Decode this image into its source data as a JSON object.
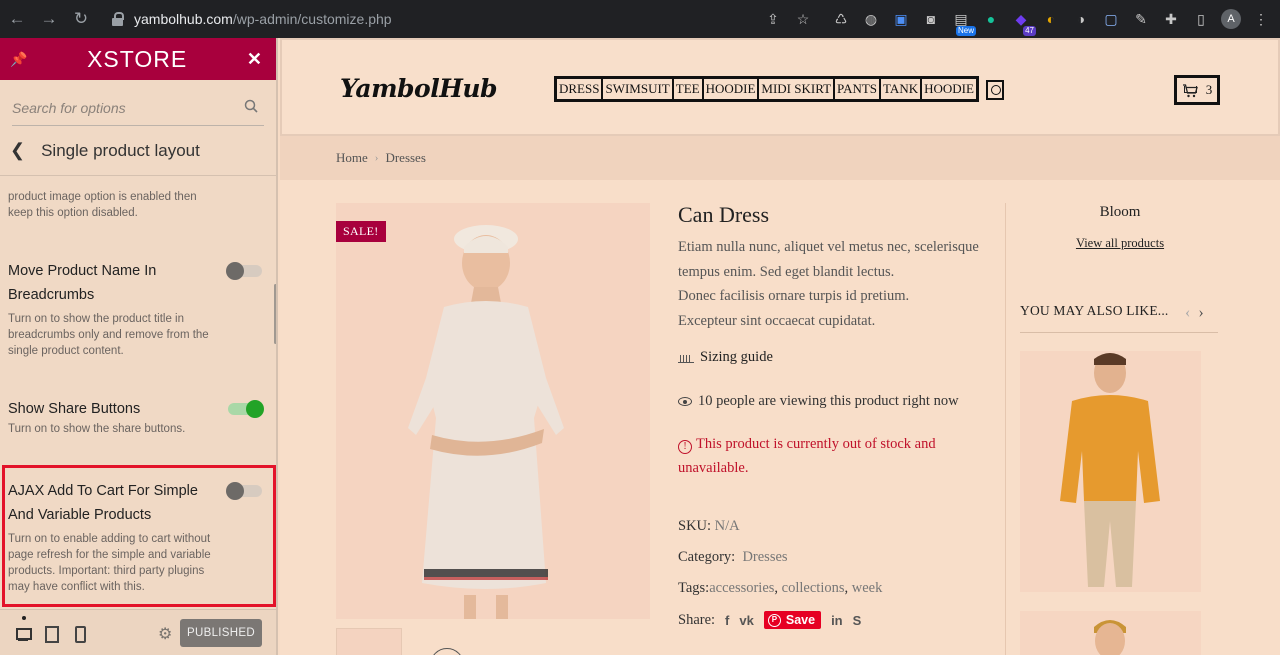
{
  "browser": {
    "url_host": "yambolhub.com",
    "url_path": "/wp-admin/customize.php",
    "ext_badge_new": "New",
    "ext_badge_count": "47",
    "avatar_letter": "A"
  },
  "sidebar": {
    "logo": "XSTORE",
    "search_placeholder": "Search for options",
    "section_title": "Single product layout",
    "partial_desc": "product image option is enabled then keep this option disabled.",
    "options": [
      {
        "title": "Move Product Name In Breadcrumbs",
        "desc": "Turn on to show the product title in breadcrumbs only and remove from the single product content.",
        "state": "off"
      },
      {
        "title": "Show Share Buttons",
        "desc": "Turn on to show the share buttons.",
        "state": "on"
      },
      {
        "title": "AJAX Add To Cart For Simple And Variable Products",
        "desc": "Turn on to enable adding to cart without page refresh for the simple and variable products. Important: third party plugins may have conflict with this.",
        "state": "off"
      }
    ],
    "publish_label": "PUBLISHED"
  },
  "site": {
    "logo": "YambolHub",
    "menu": [
      "DRESS",
      "SWIMSUIT",
      "TEE",
      "HOODIE",
      "MIDI SKIRT",
      "PANTS",
      "TANK",
      "HOODIE"
    ],
    "cart_count": "3",
    "breadcrumb": [
      "Home",
      "Dresses"
    ]
  },
  "product": {
    "sale_badge": "SALE!",
    "title": "Can Dress",
    "description": "Etiam nulla nunc, aliquet vel metus nec, scelerisque tempus enim. Sed eget blandit lectus. Donec facilisis ornare turpis id pretium. Excepteur sint occaecat cupidatat.",
    "desc_lines": [
      "Etiam nulla nunc, aliquet vel metus nec, scelerisque",
      "tempus enim. Sed eget blandit lectus.",
      "Donec facilisis ornare turpis id pretium.",
      "Excepteur sint occaecat cupidatat."
    ],
    "sizing_guide": "Sizing guide",
    "viewing": "10 people are viewing this product right now",
    "stock": "This product is currently out of stock and unavailable.",
    "sku_label": "SKU:",
    "sku_value": "N/A",
    "category_label": "Category:",
    "category_value": "Dresses",
    "tags_label": "Tags:",
    "tags": [
      "accessories",
      "collections",
      "week"
    ],
    "share_label": "Share:",
    "pin_save": "Save"
  },
  "related": {
    "brand": "Bloom",
    "view_all": "View all products",
    "heading": "YOU MAY ALSO LIKE..."
  },
  "colors": {
    "brand_primary": "#a8003d",
    "toggle_on": "#22a327",
    "highlight": "#e3132a",
    "out_of_stock": "#c0122b"
  }
}
